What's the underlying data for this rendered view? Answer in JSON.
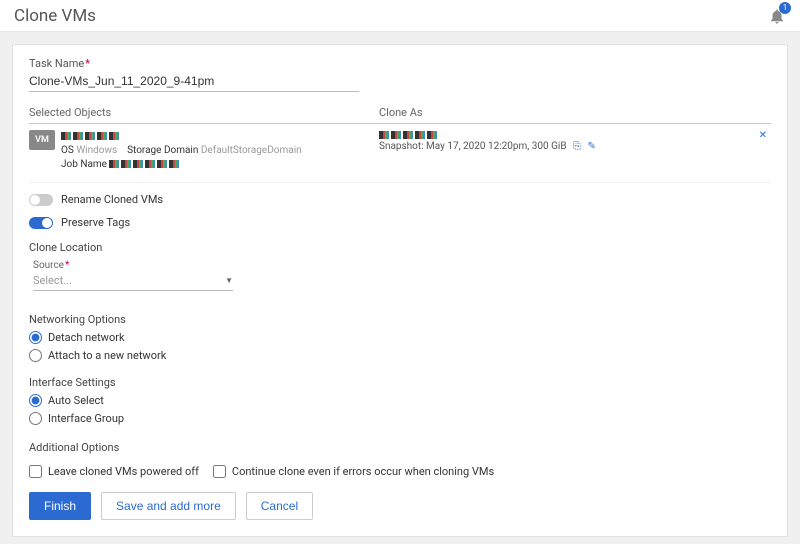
{
  "header": {
    "title": "Clone VMs",
    "notif_count": "1"
  },
  "task": {
    "label": "Task Name",
    "value": "Clone-VMs_Jun_11_2020_9-41pm"
  },
  "cols": {
    "left": "Selected Objects",
    "right": "Clone As"
  },
  "obj": {
    "vm_badge": "VM",
    "os_k": "OS",
    "os_v": "Windows",
    "sd_k": "Storage Domain",
    "sd_v": "DefaultStorageDomain",
    "job_k": "Job Name"
  },
  "cloneas": {
    "snapshot": "Snapshot: May 17, 2020 12:20pm, 300 GiB"
  },
  "toggles": {
    "rename": "Rename Cloned VMs",
    "preserve": "Preserve Tags"
  },
  "clone_loc": {
    "title": "Clone Location",
    "source_label": "Source",
    "select_ph": "Select..."
  },
  "net": {
    "title": "Networking Options",
    "detach": "Detach network",
    "attach": "Attach to a new network"
  },
  "iface": {
    "title": "Interface Settings",
    "auto": "Auto Select",
    "group": "Interface Group"
  },
  "addl": {
    "title": "Additional Options",
    "powered_off": "Leave cloned VMs powered off",
    "continue": "Continue clone even if errors occur when cloning VMs"
  },
  "actions": {
    "finish": "Finish",
    "save_more": "Save and add more",
    "cancel": "Cancel"
  }
}
